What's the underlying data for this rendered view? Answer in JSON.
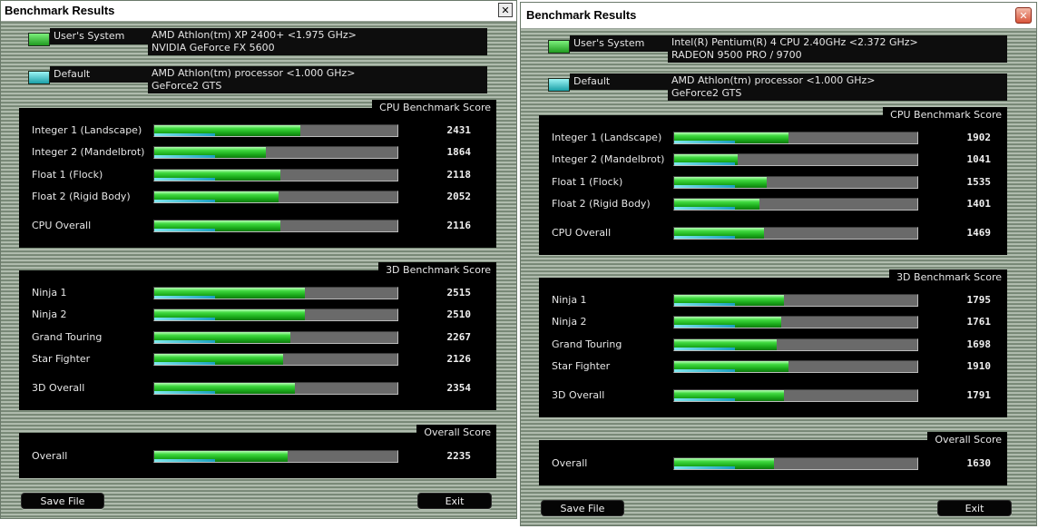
{
  "windows": [
    {
      "title": "Benchmark Results",
      "close_glyph": "✕",
      "systems": [
        {
          "label": "User's System",
          "line1": "AMD Athlon(tm) XP 2400+ <1.975 GHz>",
          "line2": "NVIDIA GeForce FX 5600",
          "swatch_color": "#2fbf2f"
        },
        {
          "label": "Default",
          "line1": "AMD Athlon(tm) processor <1.000 GHz>",
          "line2": "GeForce2 GTS",
          "swatch_color": "#1aa0a8"
        }
      ],
      "cpu": {
        "title": "CPU Benchmark Score",
        "rows": [
          {
            "label": "Integer 1 (Landscape)",
            "value": "2431",
            "fill": 0.6,
            "default_fill": 0.25
          },
          {
            "label": "Integer 2 (Mandelbrot)",
            "value": "1864",
            "fill": 0.46,
            "default_fill": 0.25
          },
          {
            "label": "Float 1 (Flock)",
            "value": "2118",
            "fill": 0.52,
            "default_fill": 0.25
          },
          {
            "label": "Float 2 (Rigid Body)",
            "value": "2052",
            "fill": 0.51,
            "default_fill": 0.25
          }
        ],
        "overall": {
          "label": "CPU Overall",
          "value": "2116",
          "fill": 0.52,
          "default_fill": 0.25
        }
      },
      "gfx": {
        "title": "3D Benchmark Score",
        "rows": [
          {
            "label": "Ninja 1",
            "value": "2515",
            "fill": 0.62,
            "default_fill": 0.25
          },
          {
            "label": "Ninja 2",
            "value": "2510",
            "fill": 0.62,
            "default_fill": 0.25
          },
          {
            "label": "Grand Touring",
            "value": "2267",
            "fill": 0.56,
            "default_fill": 0.25
          },
          {
            "label": "Star Fighter",
            "value": "2126",
            "fill": 0.53,
            "default_fill": 0.25
          }
        ],
        "overall": {
          "label": "3D Overall",
          "value": "2354",
          "fill": 0.58,
          "default_fill": 0.25
        }
      },
      "overall": {
        "title": "Overall Score",
        "label": "Overall",
        "value": "2235",
        "fill": 0.55,
        "default_fill": 0.25
      },
      "buttons": {
        "save": "Save File",
        "exit": "Exit"
      }
    },
    {
      "title": "Benchmark Results",
      "close_glyph": "✕",
      "systems": [
        {
          "label": "User's System",
          "line1": "Intel(R) Pentium(R) 4 CPU 2.40GHz <2.372 GHz>",
          "line2": "RADEON 9500 PRO / 9700",
          "swatch_color": "#2fbf2f"
        },
        {
          "label": "Default",
          "line1": "AMD Athlon(tm) processor <1.000 GHz>",
          "line2": "GeForce2 GTS",
          "swatch_color": "#1aa0a8"
        }
      ],
      "cpu": {
        "title": "CPU Benchmark Score",
        "rows": [
          {
            "label": "Integer 1 (Landscape)",
            "value": "1902",
            "fill": 0.47,
            "default_fill": 0.25
          },
          {
            "label": "Integer 2 (Mandelbrot)",
            "value": "1041",
            "fill": 0.26,
            "default_fill": 0.25
          },
          {
            "label": "Float 1 (Flock)",
            "value": "1535",
            "fill": 0.38,
            "default_fill": 0.25
          },
          {
            "label": "Float 2 (Rigid Body)",
            "value": "1401",
            "fill": 0.35,
            "default_fill": 0.25
          }
        ],
        "overall": {
          "label": "CPU Overall",
          "value": "1469",
          "fill": 0.37,
          "default_fill": 0.25
        }
      },
      "gfx": {
        "title": "3D Benchmark Score",
        "rows": [
          {
            "label": "Ninja 1",
            "value": "1795",
            "fill": 0.45,
            "default_fill": 0.25
          },
          {
            "label": "Ninja 2",
            "value": "1761",
            "fill": 0.44,
            "default_fill": 0.25
          },
          {
            "label": "Grand Touring",
            "value": "1698",
            "fill": 0.42,
            "default_fill": 0.25
          },
          {
            "label": "Star Fighter",
            "value": "1910",
            "fill": 0.47,
            "default_fill": 0.25
          }
        ],
        "overall": {
          "label": "3D Overall",
          "value": "1791",
          "fill": 0.45,
          "default_fill": 0.25
        }
      },
      "overall": {
        "title": "Overall Score",
        "label": "Overall",
        "value": "1630",
        "fill": 0.41,
        "default_fill": 0.25
      },
      "buttons": {
        "save": "Save File",
        "exit": "Exit"
      }
    }
  ]
}
